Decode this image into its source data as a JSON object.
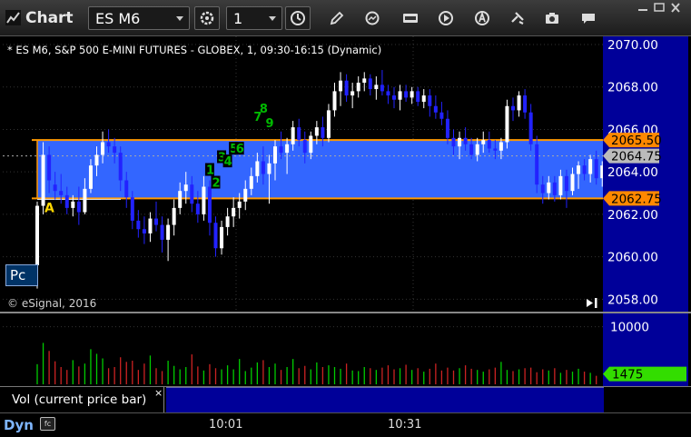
{
  "window": {
    "title": "Chart",
    "symbol": "ES M6",
    "interval": "1"
  },
  "chart_header": {
    "description": "* ES M6, S&P 500 E-MINI FUTURES - GLOBEX, 1, 09:30-16:15 (Dynamic)"
  },
  "copyright": "© eSignal, 2016",
  "volume_study": {
    "label": "Vol (current price bar)",
    "close_glyph": "×",
    "axis_tick": "10000",
    "current_value": "1475"
  },
  "time_axis": {
    "dyn_label": "Dyn",
    "fc_label": "fc",
    "ticks": [
      "10:01",
      "10:31"
    ]
  },
  "badges": {
    "pc": "Pc",
    "a_marker": "A"
  },
  "colors": {
    "up_candle": "#ffffff",
    "down_candle": "#2222ff",
    "band_fill": "#3366ff",
    "band_line": "#ff9900",
    "axis_bg": "#000099",
    "vol_up": "#00cc00",
    "vol_down": "#cc2222",
    "seq_green": "#00bb00",
    "last_price_box": "#bbbbbb",
    "vol_value_box": "#33dd00"
  },
  "chart_data": {
    "type": "candlestick",
    "ylim": [
      2057.5,
      2070.3
    ],
    "y_ticks": [
      2058,
      2060,
      2062,
      2064,
      2066,
      2068,
      2070
    ],
    "y_tick_labels": [
      "2058.00",
      "2060.00",
      "2062.00",
      "2064.00",
      "2066.00",
      "2068.00",
      "2070.00"
    ],
    "band": {
      "upper": 2065.5,
      "lower": 2062.75,
      "upper_label": "2065.50",
      "lower_label": "2062.75"
    },
    "last_price": {
      "value": 2064.75,
      "label": "2064.75"
    },
    "candles": [
      [
        2059.6,
        2062.6,
        2058.5,
        2062.4
      ],
      [
        2062.4,
        2065.4,
        2062.0,
        2064.8
      ],
      [
        2064.8,
        2065.2,
        2063.0,
        2063.6
      ],
      [
        2063.4,
        2064.0,
        2062.7,
        2063.1
      ],
      [
        2063.1,
        2063.9,
        2062.5,
        2062.9
      ],
      [
        2062.9,
        2063.3,
        2062.0,
        2062.3
      ],
      [
        2062.3,
        2062.9,
        2061.9,
        2062.6
      ],
      [
        2062.6,
        2063.3,
        2061.5,
        2062.1
      ],
      [
        2062.1,
        2063.7,
        2062.0,
        2063.2
      ],
      [
        2063.2,
        2064.6,
        2063.0,
        2064.3
      ],
      [
        2064.3,
        2065.2,
        2063.8,
        2064.8
      ],
      [
        2064.8,
        2065.9,
        2064.4,
        2065.4
      ],
      [
        2065.4,
        2066.0,
        2064.9,
        2065.2
      ],
      [
        2065.2,
        2065.6,
        2064.4,
        2064.9
      ],
      [
        2064.9,
        2065.2,
        2063.1,
        2063.6
      ],
      [
        2063.6,
        2064.0,
        2062.3,
        2062.8
      ],
      [
        2062.8,
        2063.1,
        2061.3,
        2061.7
      ],
      [
        2061.7,
        2062.2,
        2060.9,
        2061.3
      ],
      [
        2061.3,
        2061.9,
        2060.6,
        2061.1
      ],
      [
        2061.1,
        2062.1,
        2060.7,
        2061.8
      ],
      [
        2061.8,
        2062.6,
        2061.2,
        2061.5
      ],
      [
        2061.5,
        2061.9,
        2060.2,
        2060.8
      ],
      [
        2060.8,
        2061.8,
        2059.8,
        2061.5
      ],
      [
        2061.5,
        2062.7,
        2061.0,
        2062.3
      ],
      [
        2062.3,
        2063.5,
        2062.0,
        2063.1
      ],
      [
        2063.1,
        2064.0,
        2062.5,
        2063.4
      ],
      [
        2063.4,
        2063.8,
        2062.1,
        2062.5
      ],
      [
        2062.5,
        2063.1,
        2061.6,
        2062.0
      ],
      [
        2062.0,
        2063.8,
        2061.7,
        2063.3
      ],
      [
        2063.3,
        2063.6,
        2061.0,
        2061.6
      ],
      [
        2061.6,
        2061.9,
        2060.0,
        2060.4
      ],
      [
        2060.4,
        2061.7,
        2060.1,
        2061.4
      ],
      [
        2061.4,
        2062.3,
        2061.0,
        2061.9
      ],
      [
        2061.9,
        2062.8,
        2061.4,
        2062.3
      ],
      [
        2062.3,
        2063.0,
        2061.8,
        2062.6
      ],
      [
        2062.6,
        2063.6,
        2062.2,
        2063.2
      ],
      [
        2063.2,
        2064.2,
        2062.9,
        2063.8
      ],
      [
        2063.8,
        2064.9,
        2063.5,
        2064.5
      ],
      [
        2064.5,
        2065.2,
        2063.4,
        2063.9
      ],
      [
        2063.9,
        2064.8,
        2062.5,
        2064.4
      ],
      [
        2064.4,
        2065.5,
        2063.6,
        2065.2
      ],
      [
        2065.2,
        2065.9,
        2064.6,
        2064.9
      ],
      [
        2064.9,
        2065.6,
        2063.9,
        2065.3
      ],
      [
        2065.3,
        2066.4,
        2065.0,
        2066.1
      ],
      [
        2066.1,
        2066.5,
        2065.2,
        2065.5
      ],
      [
        2065.5,
        2065.9,
        2064.4,
        2064.9
      ],
      [
        2064.9,
        2065.9,
        2064.6,
        2065.7
      ],
      [
        2065.7,
        2066.4,
        2065.3,
        2066.1
      ],
      [
        2066.1,
        2066.6,
        2065.2,
        2065.6
      ],
      [
        2065.6,
        2067.2,
        2065.4,
        2066.9
      ],
      [
        2066.9,
        2068.2,
        2066.6,
        2067.8
      ],
      [
        2067.8,
        2068.7,
        2067.1,
        2068.3
      ],
      [
        2068.3,
        2068.6,
        2067.3,
        2067.6
      ],
      [
        2067.6,
        2068.2,
        2067.0,
        2067.8
      ],
      [
        2067.8,
        2068.5,
        2067.5,
        2068.2
      ],
      [
        2068.2,
        2068.7,
        2067.8,
        2068.4
      ],
      [
        2068.4,
        2068.6,
        2067.6,
        2067.9
      ],
      [
        2067.9,
        2068.5,
        2067.4,
        2068.1
      ],
      [
        2068.1,
        2068.8,
        2067.6,
        2067.8
      ],
      [
        2067.8,
        2068.1,
        2067.2,
        2067.6
      ],
      [
        2067.6,
        2068.0,
        2067.0,
        2067.4
      ],
      [
        2067.4,
        2068.1,
        2066.9,
        2067.8
      ],
      [
        2067.8,
        2068.1,
        2067.3,
        2067.5
      ],
      [
        2067.5,
        2068.0,
        2067.2,
        2067.8
      ],
      [
        2067.8,
        2068.0,
        2067.1,
        2067.3
      ],
      [
        2067.3,
        2067.9,
        2067.0,
        2067.6
      ],
      [
        2067.6,
        2067.9,
        2066.6,
        2067.1
      ],
      [
        2067.1,
        2067.6,
        2066.5,
        2066.8
      ],
      [
        2066.8,
        2067.3,
        2066.2,
        2066.5
      ],
      [
        2066.5,
        2066.9,
        2065.3,
        2065.6
      ],
      [
        2065.6,
        2066.0,
        2064.8,
        2065.2
      ],
      [
        2065.2,
        2065.9,
        2064.6,
        2065.6
      ],
      [
        2065.6,
        2066.1,
        2065.0,
        2065.3
      ],
      [
        2065.3,
        2065.6,
        2064.6,
        2064.8
      ],
      [
        2064.8,
        2065.6,
        2064.5,
        2065.3
      ],
      [
        2065.3,
        2065.9,
        2064.9,
        2065.5
      ],
      [
        2065.5,
        2065.9,
        2064.9,
        2065.1
      ],
      [
        2065.1,
        2065.5,
        2064.6,
        2065.0
      ],
      [
        2065.0,
        2065.6,
        2064.6,
        2065.4
      ],
      [
        2065.4,
        2067.4,
        2065.1,
        2067.1
      ],
      [
        2067.1,
        2067.5,
        2066.4,
        2066.9
      ],
      [
        2066.9,
        2067.8,
        2066.6,
        2067.6
      ],
      [
        2067.6,
        2067.9,
        2066.5,
        2066.8
      ],
      [
        2066.8,
        2067.2,
        2065.0,
        2065.3
      ],
      [
        2065.3,
        2065.7,
        2063.0,
        2063.4
      ],
      [
        2063.4,
        2063.8,
        2062.5,
        2063.0
      ],
      [
        2063.0,
        2063.8,
        2062.7,
        2063.5
      ],
      [
        2063.5,
        2063.8,
        2062.6,
        2062.9
      ],
      [
        2062.9,
        2064.1,
        2062.7,
        2063.8
      ],
      [
        2063.8,
        2064.1,
        2062.3,
        2063.1
      ],
      [
        2063.1,
        2064.2,
        2062.9,
        2063.9
      ],
      [
        2063.9,
        2064.5,
        2063.2,
        2064.3
      ],
      [
        2064.3,
        2064.6,
        2063.6,
        2063.9
      ],
      [
        2063.9,
        2064.8,
        2063.5,
        2064.6
      ],
      [
        2064.6,
        2065.0,
        2063.4,
        2063.7
      ],
      [
        2063.7,
        2064.5,
        2063.3,
        2064.3
      ],
      [
        2064.3,
        2064.9,
        2063.7,
        2064.6
      ]
    ],
    "sequence_labels": [
      {
        "text": "1",
        "index": 29,
        "price": 2063.9
      },
      {
        "text": "2",
        "index": 30,
        "price": 2063.3
      },
      {
        "text": "3",
        "index": 31,
        "price": 2064.5
      },
      {
        "text": "4",
        "index": 32,
        "price": 2064.3
      },
      {
        "text": "5",
        "index": 33,
        "price": 2064.9
      },
      {
        "text": "6",
        "index": 34,
        "price": 2064.9
      },
      {
        "text": "7",
        "index": 37,
        "price": 2066.4
      },
      {
        "text": "8",
        "index": 38,
        "price": 2066.8
      },
      {
        "text": "9",
        "index": 39,
        "price": 2066.1
      }
    ],
    "volume": [
      3500,
      7200,
      5800,
      4000,
      3000,
      2500,
      4200,
      3100,
      3600,
      6100,
      5300,
      4500,
      2800,
      3000,
      4700,
      3900,
      4100,
      2500,
      3600,
      5000,
      2800,
      2300,
      4100,
      3200,
      2600,
      3000,
      5200,
      3100,
      2400,
      3500,
      2800,
      2600,
      3300,
      2600,
      4400,
      2300,
      2900,
      3800,
      4200,
      3000,
      3600,
      2500,
      3000,
      4400,
      2800,
      3200,
      2600,
      3800,
      3000,
      3300,
      3000,
      2700,
      3600,
      2400,
      2300,
      3000,
      2800,
      2500,
      2900,
      3300,
      2600,
      2800,
      3400,
      2500,
      2800,
      2200,
      2700,
      3600,
      2400,
      2900,
      2400,
      2800,
      3300,
      2700,
      2500,
      2200,
      2600,
      2900,
      3900,
      2500,
      2300,
      2600,
      2800,
      2900,
      2100,
      2600,
      2400,
      2800,
      2000,
      2500,
      2200,
      2700,
      2200,
      2000,
      1475
    ],
    "vol_ylim": [
      0,
      12000
    ]
  }
}
